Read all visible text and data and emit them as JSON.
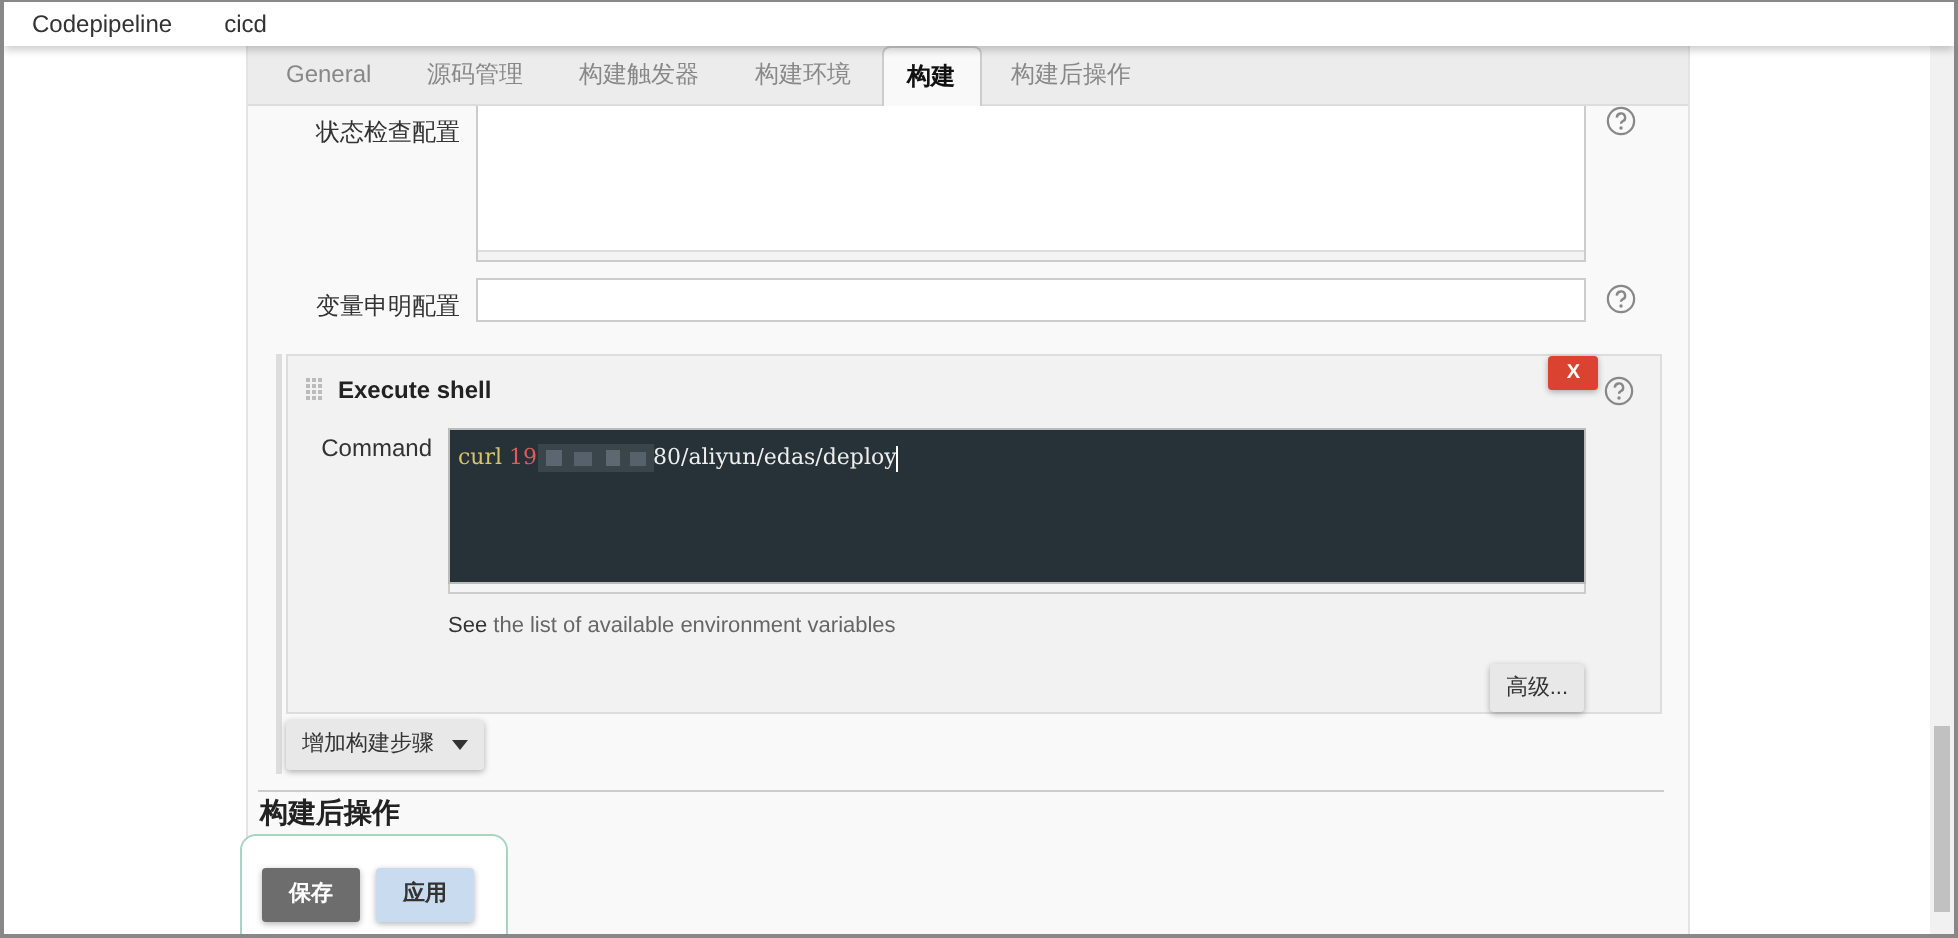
{
  "topnav": {
    "items": [
      {
        "label": "Codepipeline"
      },
      {
        "label": "cicd"
      }
    ]
  },
  "tabs": [
    {
      "label": "General",
      "selected": false
    },
    {
      "label": "源码管理",
      "selected": false
    },
    {
      "label": "构建触发器",
      "selected": false
    },
    {
      "label": "构建环境",
      "selected": false
    },
    {
      "label": "构建",
      "selected": true
    },
    {
      "label": "构建后操作",
      "selected": false
    }
  ],
  "fields": [
    {
      "label": "状态检查配置",
      "kind": "textarea"
    },
    {
      "label": "变量申明配置",
      "kind": "input"
    }
  ],
  "build_step": {
    "title": "Execute shell",
    "delete_label": "X",
    "command_label": "Command",
    "command": {
      "keyword": "curl",
      "host_visible": "19",
      "rest": "80/aliyun/edas/deploy",
      "redacted": true
    },
    "hint_prefix": "See",
    "hint_link": "the list of available environment variables",
    "advanced_button": "高级..."
  },
  "add_step_button": "增加构建步骤",
  "post_build_heading": "构建后操作",
  "footer_buttons": [
    {
      "label": "保存",
      "kind": "primary"
    },
    {
      "label": "应用",
      "kind": "secondary"
    }
  ]
}
